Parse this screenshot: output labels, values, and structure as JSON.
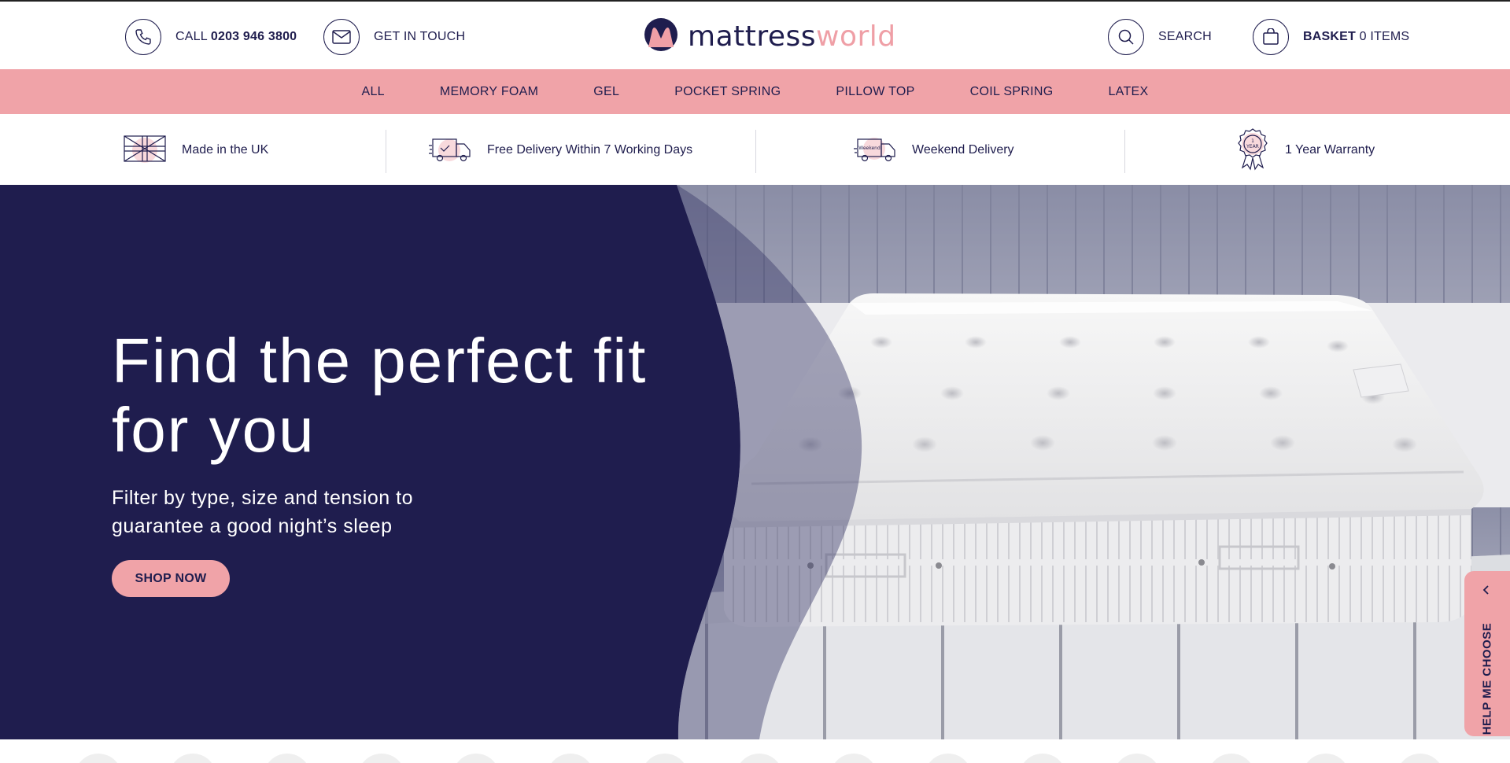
{
  "header": {
    "call_prefix": "CALL",
    "phone": "0203 946 3800",
    "contact_label": "GET IN TOUCH",
    "logo_part1": "mattress",
    "logo_part2": "world",
    "search_label": "SEARCH",
    "basket_label": "BASKET",
    "basket_count": "0 ITEMS"
  },
  "nav": {
    "items": [
      "ALL",
      "MEMORY FOAM",
      "GEL",
      "POCKET SPRING",
      "PILLOW TOP",
      "COIL SPRING",
      "LATEX"
    ]
  },
  "usp": {
    "items": [
      "Made in the UK",
      "Free Delivery Within 7 Working Days",
      "Weekend Delivery",
      "1 Year Warranty"
    ],
    "weekend_icon_text": "Weekend",
    "warranty_icon_top": "1",
    "warranty_icon_bottom": "YEAR"
  },
  "hero": {
    "title": "Find the perfect fit for you",
    "subtitle": "Filter by type, size and tension to guarantee a good night’s sleep",
    "cta": "SHOP NOW"
  },
  "help_tab": {
    "label": "HELP ME CHOOSE"
  },
  "colors": {
    "navy": "#1f1d4e",
    "pink": "#f0a3a8",
    "white": "#ffffff"
  },
  "icons": [
    "phone-icon",
    "mail-icon",
    "logo-mark-icon",
    "search-icon",
    "basket-icon",
    "uk-flag-icon",
    "delivery-truck-icon",
    "weekend-truck-icon",
    "warranty-rosette-icon",
    "chevron-left-icon"
  ]
}
